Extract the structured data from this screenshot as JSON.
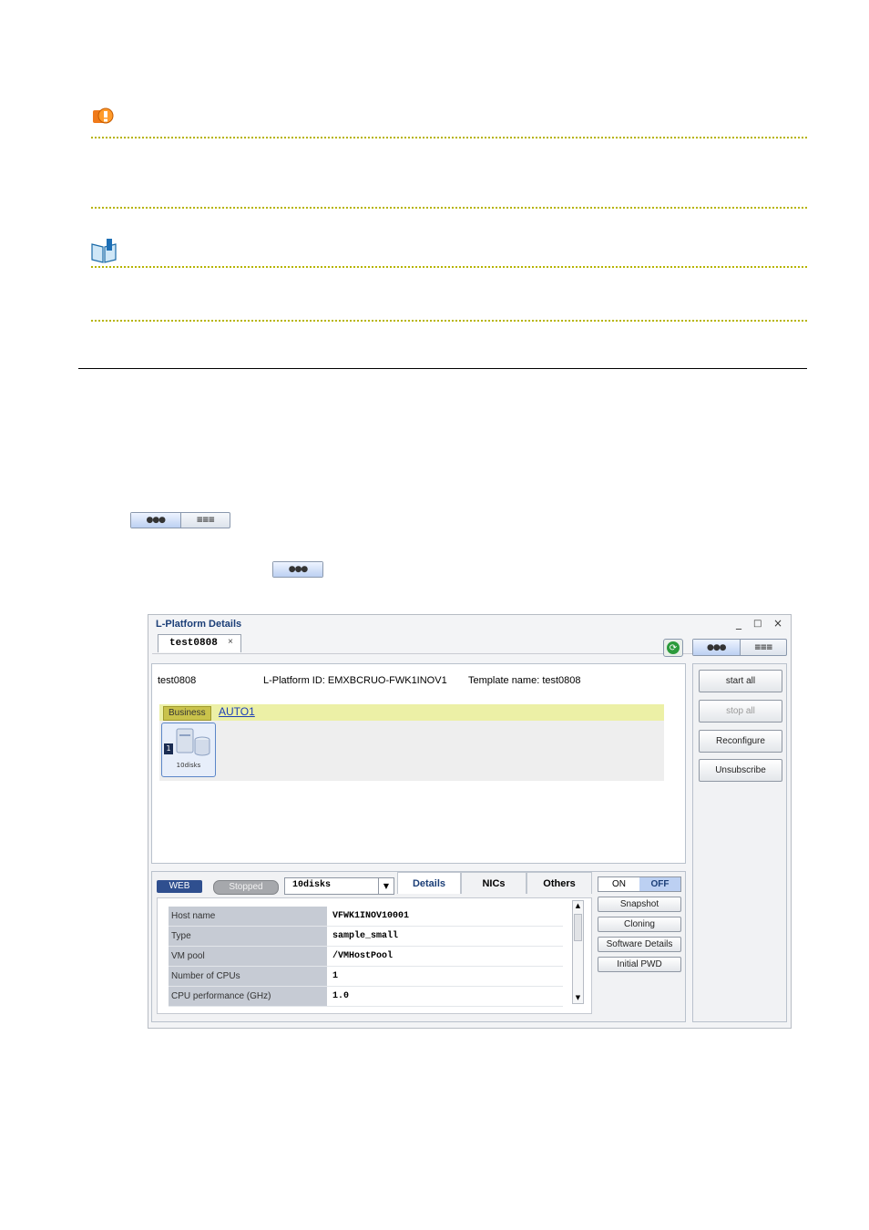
{
  "window": {
    "title": "L-Platform Details",
    "minimize": "_",
    "maximize": "□",
    "close": "×"
  },
  "tab": {
    "label": "test0808",
    "close": "×"
  },
  "header": {
    "name": "test0808",
    "lplatform_id": "L-Platform ID: EMXBCRUO-FWK1INOV1",
    "template": "Template name: test0808"
  },
  "segment_icon_label": "●●●",
  "segment_list_label": "≡≡≡",
  "business": {
    "tag": "Business",
    "link": "AUTO1"
  },
  "server": {
    "number": "1",
    "label": "10disks"
  },
  "side_buttons": {
    "start_all": "start all",
    "stop_all": "stop all",
    "reconfigure": "Reconfigure",
    "unsubscribe": "Unsubscribe"
  },
  "detail": {
    "segment": "WEB",
    "status": "Stopped",
    "server_select": "10disks",
    "tabs": [
      "Details",
      "NICs",
      "Others"
    ],
    "rows": [
      {
        "key": "Host name",
        "value": "VFWK1INOV10001"
      },
      {
        "key": "Type",
        "value": "sample_small"
      },
      {
        "key": "VM pool",
        "value": "/VMHostPool"
      },
      {
        "key": "Number of CPUs",
        "value": "1"
      },
      {
        "key": "CPU performance (GHz)",
        "value": "1.0"
      }
    ]
  },
  "power": {
    "on": "ON",
    "off": "OFF"
  },
  "ops": {
    "snapshot": "Snapshot",
    "cloning": "Cloning",
    "software_details": "Software Details",
    "initial_pwd": "Initial PWD"
  },
  "colors": {
    "accent": "#1b3e77",
    "business_bar": "#ecf0a6",
    "dotted_rule": "#b7b400"
  }
}
